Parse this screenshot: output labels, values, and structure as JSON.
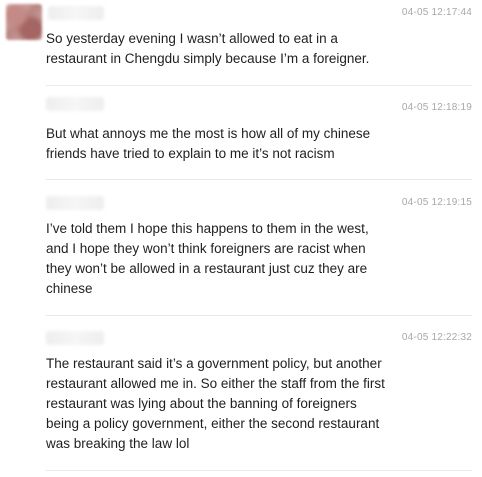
{
  "messages": [
    {
      "timestamp": "04-05 12:17:44",
      "text": "So yesterday evening I wasn’t allowed to eat in a\nrestaurant in Chengdu simply because I’m a foreigner."
    },
    {
      "timestamp": "04-05 12:18:19",
      "text": "But what annoys me the most is how all of my chinese\nfriends have tried to explain to me it’s not racism"
    },
    {
      "timestamp": "04-05 12:19:15",
      "text": "I’ve told them I hope this happens to them in the west,\nand I hope they won’t think foreigners are racist when\nthey won’t be allowed in a restaurant just cuz they are\nchinese"
    },
    {
      "timestamp": "04-05 12:22:32",
      "text": "The restaurant said it’s a government policy, but another\nrestaurant allowed me in. So either the staff from the first\nrestaurant was lying about the banning of foreigners\nbeing a policy government, either the second restaurant\nwas breaking the law lol"
    }
  ]
}
